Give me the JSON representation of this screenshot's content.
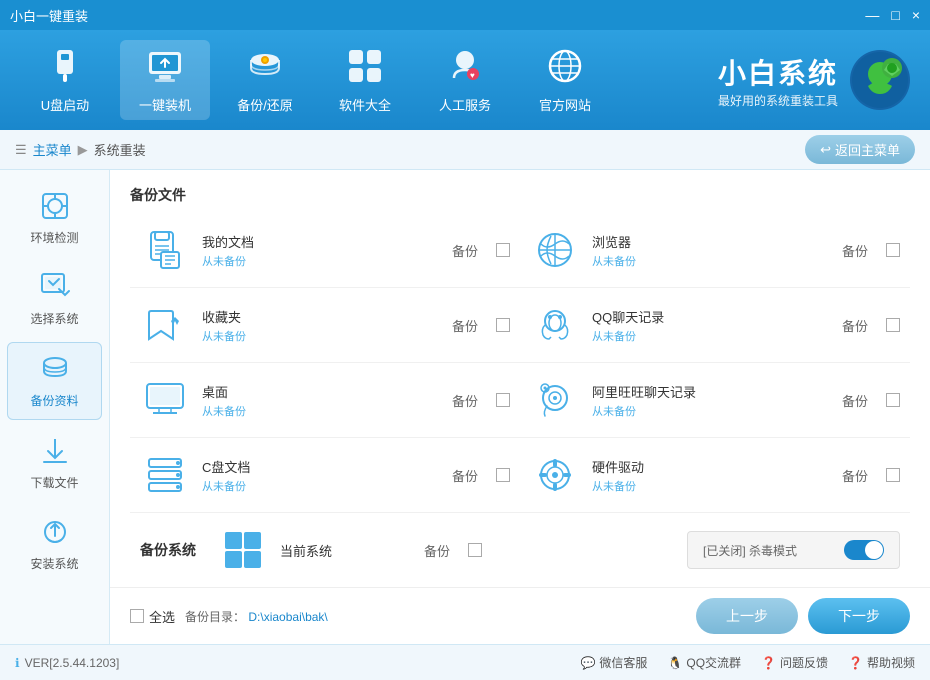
{
  "titleBar": {
    "title": "小白一键重装",
    "controls": [
      "—",
      "□",
      "×"
    ]
  },
  "topNav": {
    "items": [
      {
        "id": "usb",
        "label": "U盘启动",
        "icon": "usb"
      },
      {
        "id": "onekey",
        "label": "一键装机",
        "icon": "onekey"
      },
      {
        "id": "backup",
        "label": "备份/还原",
        "icon": "backup"
      },
      {
        "id": "software",
        "label": "软件大全",
        "icon": "software"
      },
      {
        "id": "service",
        "label": "人工服务",
        "icon": "service",
        "active": true
      },
      {
        "id": "website",
        "label": "官方网站",
        "icon": "website"
      }
    ],
    "brand": {
      "name": "小白系统",
      "subtitle": "最好用的系统重装工具"
    }
  },
  "breadcrumb": {
    "home": "主菜单",
    "current": "系统重装",
    "backLabel": "返回主菜单"
  },
  "sidebar": {
    "items": [
      {
        "id": "env",
        "label": "环境检测",
        "icon": "⚙"
      },
      {
        "id": "select",
        "label": "选择系统",
        "icon": "🖱"
      },
      {
        "id": "backup",
        "label": "备份资料",
        "icon": "💾",
        "active": true
      },
      {
        "id": "download",
        "label": "下载文件",
        "icon": "⬇"
      },
      {
        "id": "install",
        "label": "安装系统",
        "icon": "🔧"
      }
    ]
  },
  "backupSection": {
    "title": "备份文件",
    "items": [
      {
        "id": "mydoc",
        "name": "我的文档",
        "status": "从未备份",
        "icon": "doc"
      },
      {
        "id": "bookmark",
        "name": "收藏夹",
        "status": "从未备份",
        "icon": "folder-star"
      },
      {
        "id": "desktop",
        "name": "桌面",
        "status": "从未备份",
        "icon": "monitor"
      },
      {
        "id": "cdoc",
        "name": "C盘文档",
        "status": "从未备份",
        "icon": "server"
      }
    ],
    "rightItems": [
      {
        "id": "browser",
        "name": "浏览器",
        "status": "从未备份",
        "icon": "browser"
      },
      {
        "id": "qq",
        "name": "QQ聊天记录",
        "status": "从未备份",
        "icon": "qq"
      },
      {
        "id": "aliww",
        "name": "阿里旺旺聊天记录",
        "status": "从未备份",
        "icon": "aliww"
      },
      {
        "id": "driver",
        "name": "硬件驱动",
        "status": "从未备份",
        "icon": "driver"
      }
    ]
  },
  "backupSystem": {
    "sectionLabel": "备份系统",
    "itemName": "当前系统",
    "backupLabel": "备份",
    "antivirusLabel": "[已关闭] 杀毒模式",
    "toggleState": true
  },
  "bottomBar": {
    "selectAllLabel": "全选",
    "backupDirLabel": "备份目录：",
    "backupDirPath": "D:\\xiaobai\\bak\\",
    "prevButton": "上一步",
    "nextButton": "下一步"
  },
  "footer": {
    "version": "VER[2.5.44.1203]",
    "links": [
      {
        "id": "wechat",
        "label": "微信客服",
        "icon": "💬"
      },
      {
        "id": "qqgroup",
        "label": "QQ交流群",
        "icon": "🐧"
      },
      {
        "id": "feedback",
        "label": "问题反馈",
        "icon": "❓"
      },
      {
        "id": "video",
        "label": "帮助视频",
        "icon": "❓"
      }
    ]
  },
  "colors": {
    "primary": "#1a87cc",
    "lightBlue": "#4ab0e8",
    "navBg": "#2096d4",
    "sidebarBg": "#f5fafd",
    "accent": "#5cc0f0"
  }
}
